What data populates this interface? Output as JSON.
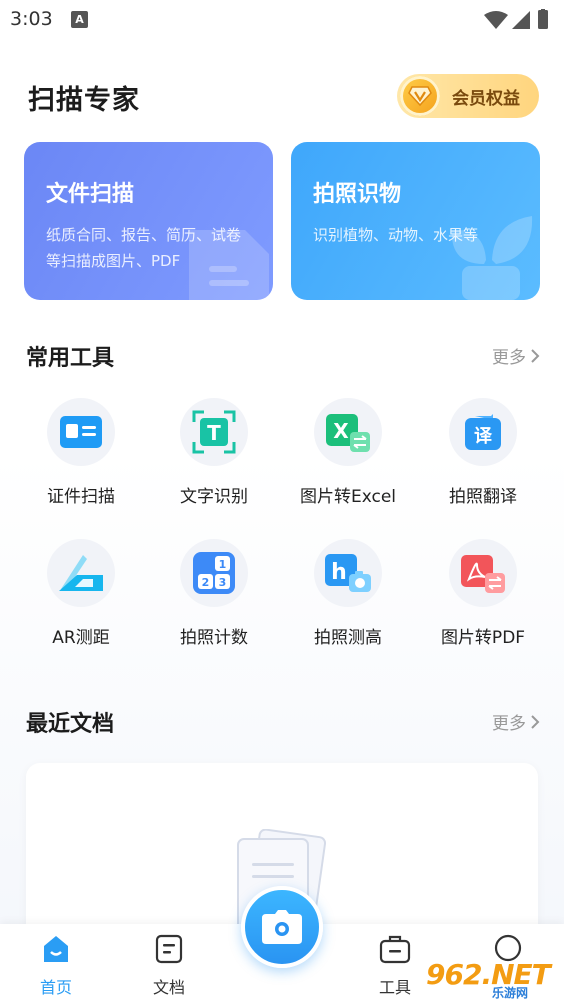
{
  "status_bar": {
    "time": "3:03",
    "notif_letter": "A"
  },
  "header": {
    "title": "扫描专家",
    "vip_label": "会员权益"
  },
  "cards": [
    {
      "title": "文件扫描",
      "desc": "纸质合同、报告、简历、试卷等扫描成图片、PDF"
    },
    {
      "title": "拍照识物",
      "desc": "识别植物、动物、水果等"
    }
  ],
  "tools_section": {
    "title": "常用工具",
    "more": "更多"
  },
  "tools": [
    {
      "label": "证件扫描",
      "icon": "id-card-icon"
    },
    {
      "label": "文字识别",
      "icon": "text-recognition-icon",
      "glyph": "T"
    },
    {
      "label": "图片转Excel",
      "icon": "excel-icon",
      "glyph": "X"
    },
    {
      "label": "拍照翻译",
      "icon": "translate-icon",
      "glyph": "译"
    },
    {
      "label": "AR测距",
      "icon": "ruler-icon"
    },
    {
      "label": "拍照计数",
      "icon": "counter-icon",
      "glyph": "1 2 3"
    },
    {
      "label": "拍照测高",
      "icon": "height-icon",
      "glyph": "h"
    },
    {
      "label": "图片转PDF",
      "icon": "pdf-icon"
    }
  ],
  "recent_section": {
    "title": "最近文档",
    "more": "更多"
  },
  "nav": [
    {
      "label": "首页",
      "icon": "home-icon",
      "active": true
    },
    {
      "label": "文档",
      "icon": "document-icon"
    },
    {
      "label": "",
      "icon": "camera-icon"
    },
    {
      "label": "工具",
      "icon": "toolbox-icon"
    },
    {
      "label": "",
      "icon": "profile-icon"
    }
  ],
  "watermark": {
    "main": "962.NET",
    "sub": "乐游网"
  },
  "colors": {
    "accent": "#2a9df4",
    "scan_card": "#6b87f5",
    "photo_card": "#3fa7fb",
    "vip": "#ffd57e"
  }
}
